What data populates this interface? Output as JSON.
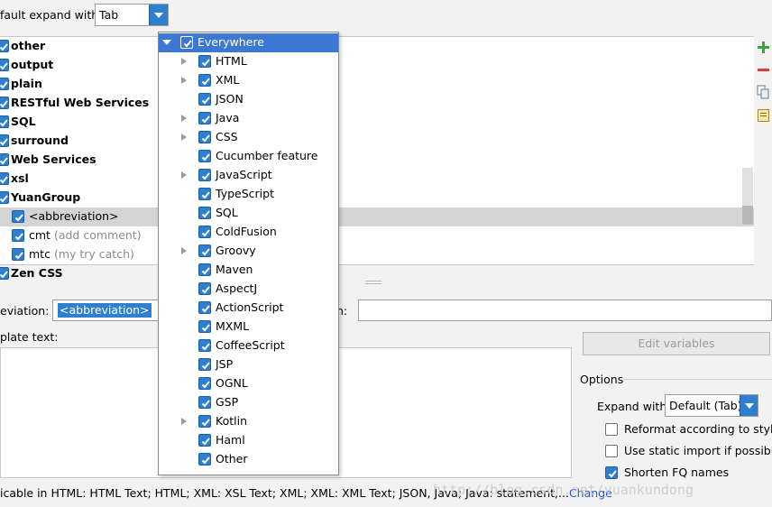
{
  "top": {
    "label": "fault expand with",
    "combo_value": "Tab"
  },
  "tree": {
    "rows": [
      {
        "label": "other",
        "comment": "",
        "bold": true,
        "indent": false,
        "selected": false
      },
      {
        "label": "output",
        "comment": "",
        "bold": true,
        "indent": false,
        "selected": false
      },
      {
        "label": "plain",
        "comment": "",
        "bold": true,
        "indent": false,
        "selected": false
      },
      {
        "label": "RESTful Web Services",
        "comment": "",
        "bold": true,
        "indent": false,
        "selected": false
      },
      {
        "label": "SQL",
        "comment": "",
        "bold": true,
        "indent": false,
        "selected": false
      },
      {
        "label": "surround",
        "comment": "",
        "bold": true,
        "indent": false,
        "selected": false
      },
      {
        "label": "Web Services",
        "comment": "",
        "bold": true,
        "indent": false,
        "selected": false
      },
      {
        "label": "xsl",
        "comment": "",
        "bold": true,
        "indent": false,
        "selected": false
      },
      {
        "label": "YuanGroup",
        "comment": "",
        "bold": true,
        "indent": false,
        "selected": false
      },
      {
        "label": "<abbreviation>",
        "comment": "",
        "bold": false,
        "indent": true,
        "selected": true
      },
      {
        "label": "cmt",
        "comment": "(add comment)",
        "bold": false,
        "indent": true,
        "selected": false
      },
      {
        "label": "mtc",
        "comment": "(my try catch)",
        "bold": false,
        "indent": true,
        "selected": false
      },
      {
        "label": "Zen CSS",
        "comment": "",
        "bold": true,
        "indent": false,
        "selected": false
      }
    ]
  },
  "popup": {
    "root": "Everywhere",
    "items": [
      {
        "label": "HTML",
        "expandable": true
      },
      {
        "label": "XML",
        "expandable": true
      },
      {
        "label": "JSON",
        "expandable": false
      },
      {
        "label": "Java",
        "expandable": true
      },
      {
        "label": "CSS",
        "expandable": true
      },
      {
        "label": "Cucumber feature",
        "expandable": false
      },
      {
        "label": "JavaScript",
        "expandable": true
      },
      {
        "label": "TypeScript",
        "expandable": false
      },
      {
        "label": "SQL",
        "expandable": false
      },
      {
        "label": "ColdFusion",
        "expandable": false
      },
      {
        "label": "Groovy",
        "expandable": true
      },
      {
        "label": "Maven",
        "expandable": false
      },
      {
        "label": "AspectJ",
        "expandable": false
      },
      {
        "label": "ActionScript",
        "expandable": false
      },
      {
        "label": "MXML",
        "expandable": false
      },
      {
        "label": "CoffeeScript",
        "expandable": false
      },
      {
        "label": "JSP",
        "expandable": false
      },
      {
        "label": "OGNL",
        "expandable": false
      },
      {
        "label": "GSP",
        "expandable": false
      },
      {
        "label": "Kotlin",
        "expandable": true
      },
      {
        "label": "Haml",
        "expandable": false
      },
      {
        "label": "Other",
        "expandable": false
      }
    ]
  },
  "editor": {
    "abbr_label": "eviation:",
    "abbr_value": "<abbreviation>",
    "desc_label": "n:",
    "template_label": "plate text:",
    "edit_variables": "Edit variables"
  },
  "options": {
    "title": "Options",
    "expand_with_label": "Expand with",
    "expand_with_value": "Default (Tab)",
    "checks": [
      {
        "label": "Reformat according to style",
        "checked": false
      },
      {
        "label": "Use static import if possible",
        "checked": false
      },
      {
        "label": "Shorten FQ names",
        "checked": true
      }
    ]
  },
  "footer": {
    "text": "icable in HTML: HTML Text; HTML; XML: XSL Text; XML; XML: XML Text; JSON, Java; Java: statement,...",
    "link": "Change"
  },
  "watermark": "http://blog.csdn.net/yuankundong",
  "colors": {
    "accent": "#2f7fd0",
    "selection": "#3a78d4",
    "add": "#3aa63a",
    "remove": "#d83c3c"
  }
}
